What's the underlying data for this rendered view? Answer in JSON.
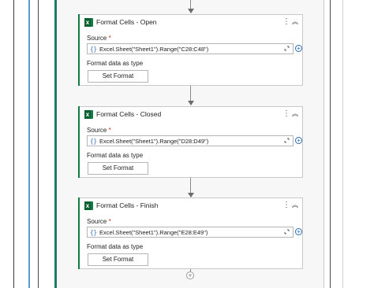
{
  "workflow": {
    "steps": [
      {
        "title": "Format Cells - Open",
        "source_label": "Source",
        "required_mark": "*",
        "source_value": "Excel.Sheet(\"Sheet1\").Range(\"C28:C48\")",
        "type_label": "Format data as type",
        "button_label": "Set Format"
      },
      {
        "title": "Format Cells - Closed",
        "source_label": "Source",
        "required_mark": "*",
        "source_value": "Excel.Sheet(\"Sheet1\").Range(\"D28:D49\")",
        "type_label": "Format data as type",
        "button_label": "Set Format"
      },
      {
        "title": "Format Cells - Finish",
        "source_label": "Source",
        "required_mark": "*",
        "source_value": "Excel.Sheet(\"Sheet1\").Range(\"E28:E49\")",
        "type_label": "Format data as type",
        "button_label": "Set Format"
      }
    ],
    "icons": {
      "activity": "excel-icon",
      "more": "more-options-icon",
      "collapse": "collapse-icon",
      "expression": "expression-braces-icon",
      "expand": "expand-editor-icon",
      "add": "plus-circle-icon",
      "add_step": "add-activity-icon"
    },
    "colors": {
      "excel_green": "#107c41",
      "container_accent": "#1d7a65",
      "link_blue": "#2b6cb0",
      "required_red": "#c42b1c",
      "outline_blue": "#5b9bd5"
    }
  }
}
